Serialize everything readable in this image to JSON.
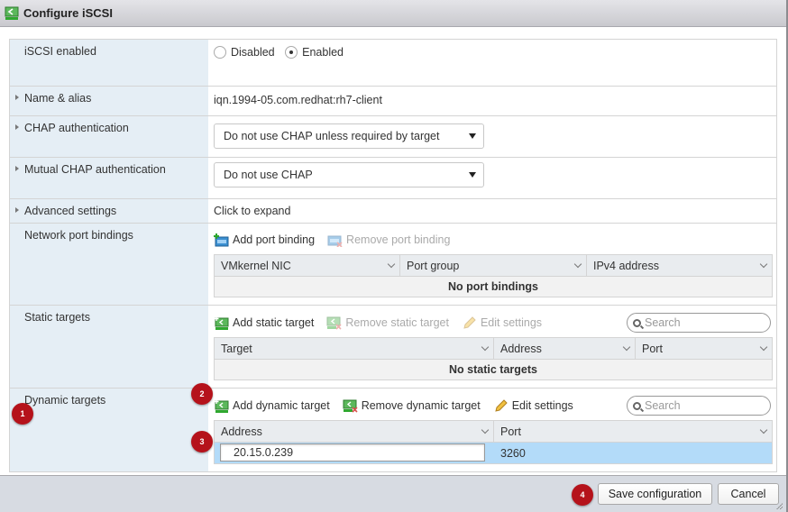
{
  "window": {
    "title": "Configure iSCSI",
    "icon": "iscsi-storage-icon"
  },
  "settings": {
    "iscsi_enabled": {
      "label": "iSCSI enabled",
      "options": [
        "Disabled",
        "Enabled"
      ],
      "selected": "Enabled"
    },
    "name_alias": {
      "label": "Name & alias",
      "value": "iqn.1994-05.com.redhat:rh7-client"
    },
    "chap": {
      "label": "CHAP authentication",
      "selected": "Do not use CHAP unless required by target"
    },
    "mutual_chap": {
      "label": "Mutual CHAP authentication",
      "selected": "Do not use CHAP"
    },
    "advanced": {
      "label": "Advanced settings",
      "value": "Click to expand"
    },
    "port_bindings": {
      "label": "Network port bindings",
      "toolbar": {
        "add": "Add port binding",
        "remove": "Remove port binding"
      },
      "columns": [
        "VMkernel NIC",
        "Port group",
        "IPv4 address"
      ],
      "empty_text": "No port bindings"
    },
    "static_targets": {
      "label": "Static targets",
      "toolbar": {
        "add": "Add static target",
        "remove": "Remove static target",
        "edit": "Edit settings"
      },
      "search_placeholder": "Search",
      "columns": [
        "Target",
        "Address",
        "Port"
      ],
      "empty_text": "No static targets"
    },
    "dynamic_targets": {
      "label": "Dynamic targets",
      "toolbar": {
        "add": "Add dynamic target",
        "remove": "Remove dynamic target",
        "edit": "Edit settings"
      },
      "search_placeholder": "Search",
      "columns": [
        "Address",
        "Port"
      ],
      "rows": [
        {
          "address": "20.15.0.239",
          "port": "3260"
        }
      ]
    }
  },
  "callouts": [
    "1",
    "2",
    "3",
    "4"
  ],
  "footer": {
    "save_label": "Save configuration",
    "cancel_label": "Cancel"
  },
  "colors": {
    "label_bg": "#e5eef5",
    "selected_row": "#b3dbf9",
    "callout": "#b5121b"
  }
}
